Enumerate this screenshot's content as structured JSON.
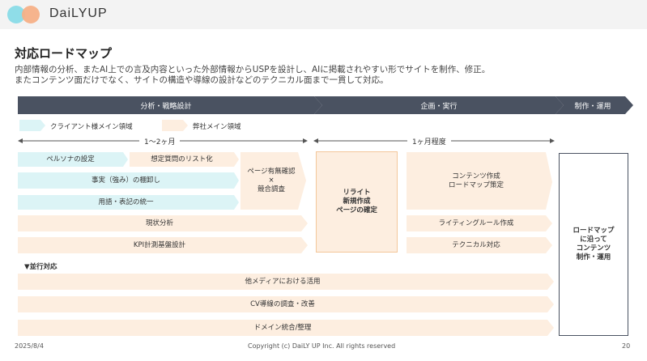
{
  "brand": "DaiLYUP",
  "title": "対応ロードマップ",
  "description": [
    "内部情報の分析、またAI上での言及内容といった外部情報からUSPを設計し、AIに掲載されやすい形でサイトを制作、修正。",
    "またコンテンツ面だけでなく、サイトの構造や導線の設計などのテクニカル面まで一貫して対応。"
  ],
  "phases": [
    "分析・戦略設計",
    "企画・実行",
    "制作・運用"
  ],
  "legend": {
    "client": "クライアント様メイン領域",
    "company": "弊社メイン領域"
  },
  "durations": [
    "1～2ヶ月",
    "1ヶ月程度"
  ],
  "analysis": {
    "persona": "ペルソナの設定",
    "questions": "想定質問のリスト化",
    "facts": "事実（強み）の棚卸し",
    "terms": "用語・表記の統一",
    "page_check": [
      "ページ有無確認",
      "×",
      "競合調査"
    ],
    "current": "現状分析",
    "kpi": "KPI計測基盤設計"
  },
  "rewrite": [
    "リライト",
    "新規作成",
    "ページの確定"
  ],
  "planning": {
    "content": [
      "コンテンツ作成",
      "ロードマップ策定"
    ],
    "writing_rule": "ライティングルール作成",
    "technical": "テクニカル対応"
  },
  "operation": [
    "ロードマップ",
    "に沿って",
    "コンテンツ",
    "制作・運用"
  ],
  "parallel": {
    "label": "▼並行対応",
    "items": [
      "他メディアにおける活用",
      "CV導線の調査・改善",
      "ドメイン統合/整理"
    ]
  },
  "colors": {
    "phase_bar": "#4a5261",
    "client": "#dcf4f6",
    "company": "#fdeee0",
    "accent_border": "#f3c79a"
  },
  "footer": {
    "date": "2025/8/4",
    "copyright": "Copyright (c) DaiLY UP Inc. All rights reserved",
    "page": "20"
  }
}
